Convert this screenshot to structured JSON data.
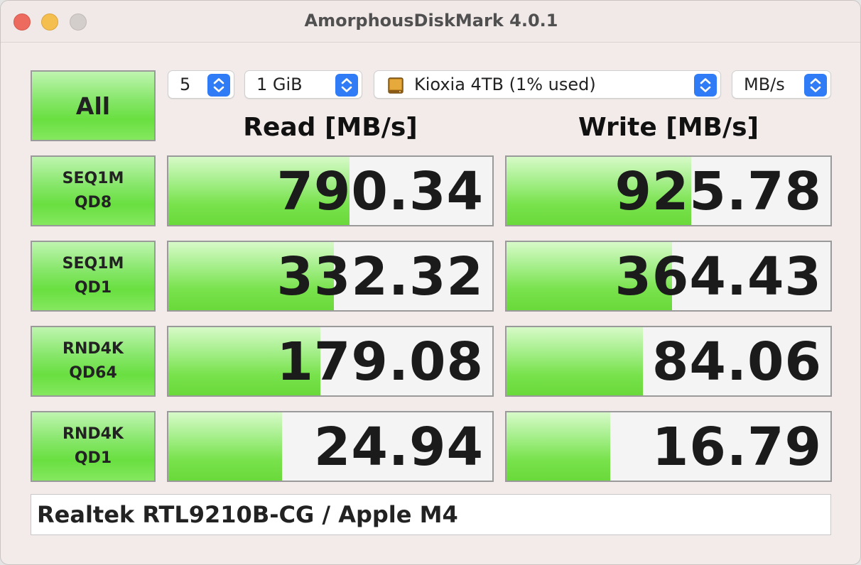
{
  "window": {
    "title": "AmorphousDiskMark 4.0.1"
  },
  "controls": {
    "all_button": "All",
    "count": {
      "selected": "5"
    },
    "size": {
      "selected": "1 GiB"
    },
    "drive": {
      "selected": "Kioxia 4TB (1% used)",
      "icon": "drive-icon"
    },
    "unit": {
      "selected": "MB/s"
    }
  },
  "headers": {
    "read": "Read [MB/s]",
    "write": "Write [MB/s]"
  },
  "tests": [
    {
      "line1": "SEQ1M",
      "line2": "QD8",
      "read": "790.34",
      "write": "925.78",
      "read_fill": 0.56,
      "write_fill": 0.57
    },
    {
      "line1": "SEQ1M",
      "line2": "QD1",
      "read": "332.32",
      "write": "364.43",
      "read_fill": 0.51,
      "write_fill": 0.51
    },
    {
      "line1": "RND4K",
      "line2": "QD64",
      "read": "179.08",
      "write": "84.06",
      "read_fill": 0.47,
      "write_fill": 0.42
    },
    {
      "line1": "RND4K",
      "line2": "QD1",
      "read": "24.94",
      "write": "16.79",
      "read_fill": 0.35,
      "write_fill": 0.32
    }
  ],
  "footer": {
    "text": "Realtek RTL9210B-CG / Apple M4"
  },
  "colors": {
    "accent": "#2f7cf6",
    "button_green": "#69df40",
    "bar_green": "#78e24c",
    "close": "#ed6a5e",
    "minimize": "#f5bf4f"
  }
}
